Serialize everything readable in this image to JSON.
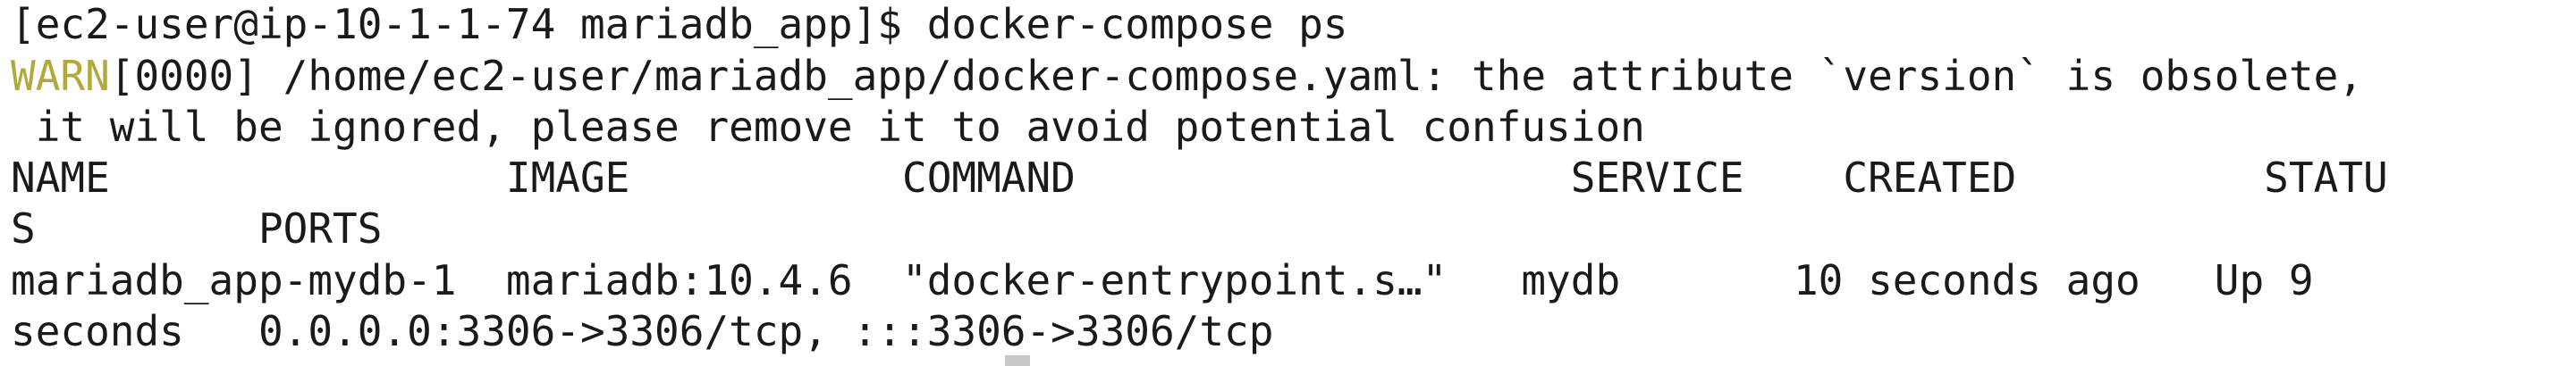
{
  "prompt": "[ec2-user@ip-10-1-1-74 mariadb_app]$ docker-compose ps",
  "warning": {
    "tag": "WARN",
    "line1_rest": "[0000] /home/ec2-user/mariadb_app/docker-compose.yaml: the attribute `version` is obsolete,",
    "line2": " it will be ignored, please remove it to avoid potential confusion"
  },
  "table": {
    "header_line1": "NAME                IMAGE           COMMAND                    SERVICE    CREATED          STATU",
    "header_line2": "S         PORTS",
    "row_line1": "mariadb_app-mydb-1  mariadb:10.4.6  \"docker-entrypoint.s…\"   mydb       10 seconds ago   Up 9",
    "row_line2": "seconds   0.0.0.0:3306->3306/tcp, :::3306->3306/tcp"
  },
  "colors": {
    "background": "#ffffff",
    "text": "#1a1a1a",
    "warn": "#b2a93a"
  }
}
